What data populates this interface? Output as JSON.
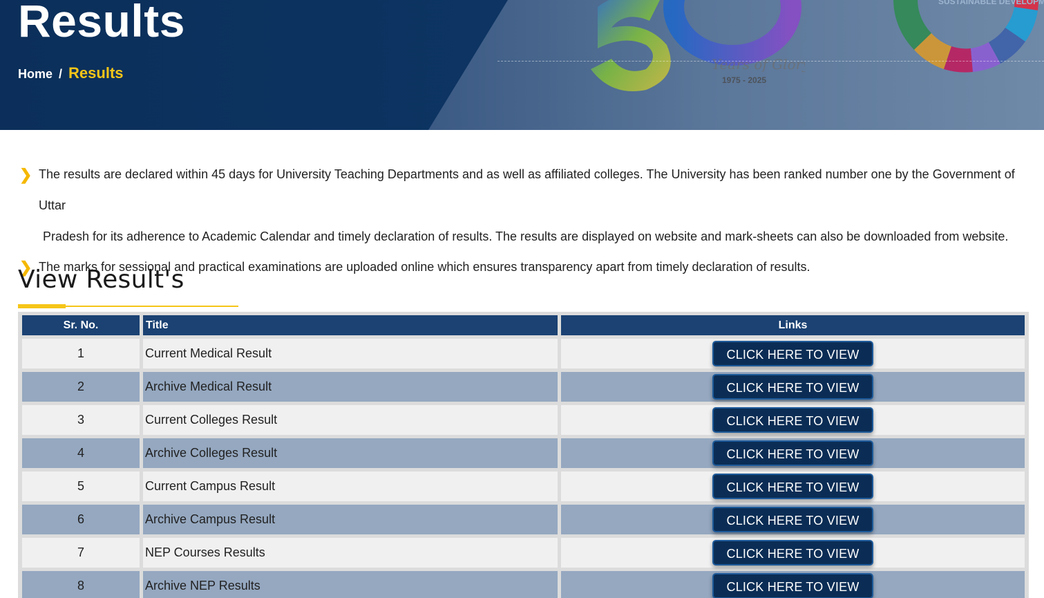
{
  "banner": {
    "title": "Results",
    "logo_years": "1975 - 2025",
    "logo_script": "Years of Glory",
    "sdg_label": "SUSTAINABLE DEVELOPMENT GOALS"
  },
  "breadcrumb": {
    "home": "Home",
    "separator": "/",
    "current": "Results"
  },
  "intro": {
    "bullets": [
      {
        "line1": "The results are declared within 45 days for University Teaching Departments and as well as affiliated colleges. The University has been ranked number one by the Government of Uttar",
        "line2": "Pradesh for its adherence to Academic Calendar and timely declaration of results. The results are displayed on website and mark-sheets can also be downloaded from website."
      },
      {
        "line1": "The marks for sessional and practical  examinations are uploaded online which ensures transparency apart from timely declaration of results."
      }
    ]
  },
  "section": {
    "title": "View Result's"
  },
  "table": {
    "headers": {
      "sr": "Sr. No.",
      "title": "Title",
      "links": "Links"
    },
    "rows": [
      {
        "sr": "1",
        "title": "Current Medical Result",
        "link": "CLICK HERE TO VIEW"
      },
      {
        "sr": "2",
        "title": "Archive Medical Result",
        "link": "CLICK HERE TO VIEW"
      },
      {
        "sr": "3",
        "title": "Current Colleges Result",
        "link": "CLICK HERE TO VIEW"
      },
      {
        "sr": "4",
        "title": "Archive Colleges Result",
        "link": "CLICK HERE TO VIEW"
      },
      {
        "sr": "5",
        "title": "Current Campus Result",
        "link": "CLICK HERE TO VIEW"
      },
      {
        "sr": "6",
        "title": "Archive Campus Result",
        "link": "CLICK HERE TO VIEW"
      },
      {
        "sr": "7",
        "title": "NEP Courses Results",
        "link": "CLICK HERE TO VIEW"
      },
      {
        "sr": "8",
        "title": "Archive NEP Results",
        "link": "CLICK HERE TO VIEW"
      }
    ]
  },
  "colors": {
    "banner_dark": "#0b2f5a",
    "accent_yellow": "#f5c518",
    "header_blue": "#1b4273",
    "button_navy": "#0b2d55",
    "row_alt": "#95a8c0",
    "row_light": "#f0f0f0"
  },
  "icons": {
    "bullet": "chevron-right-icon"
  }
}
